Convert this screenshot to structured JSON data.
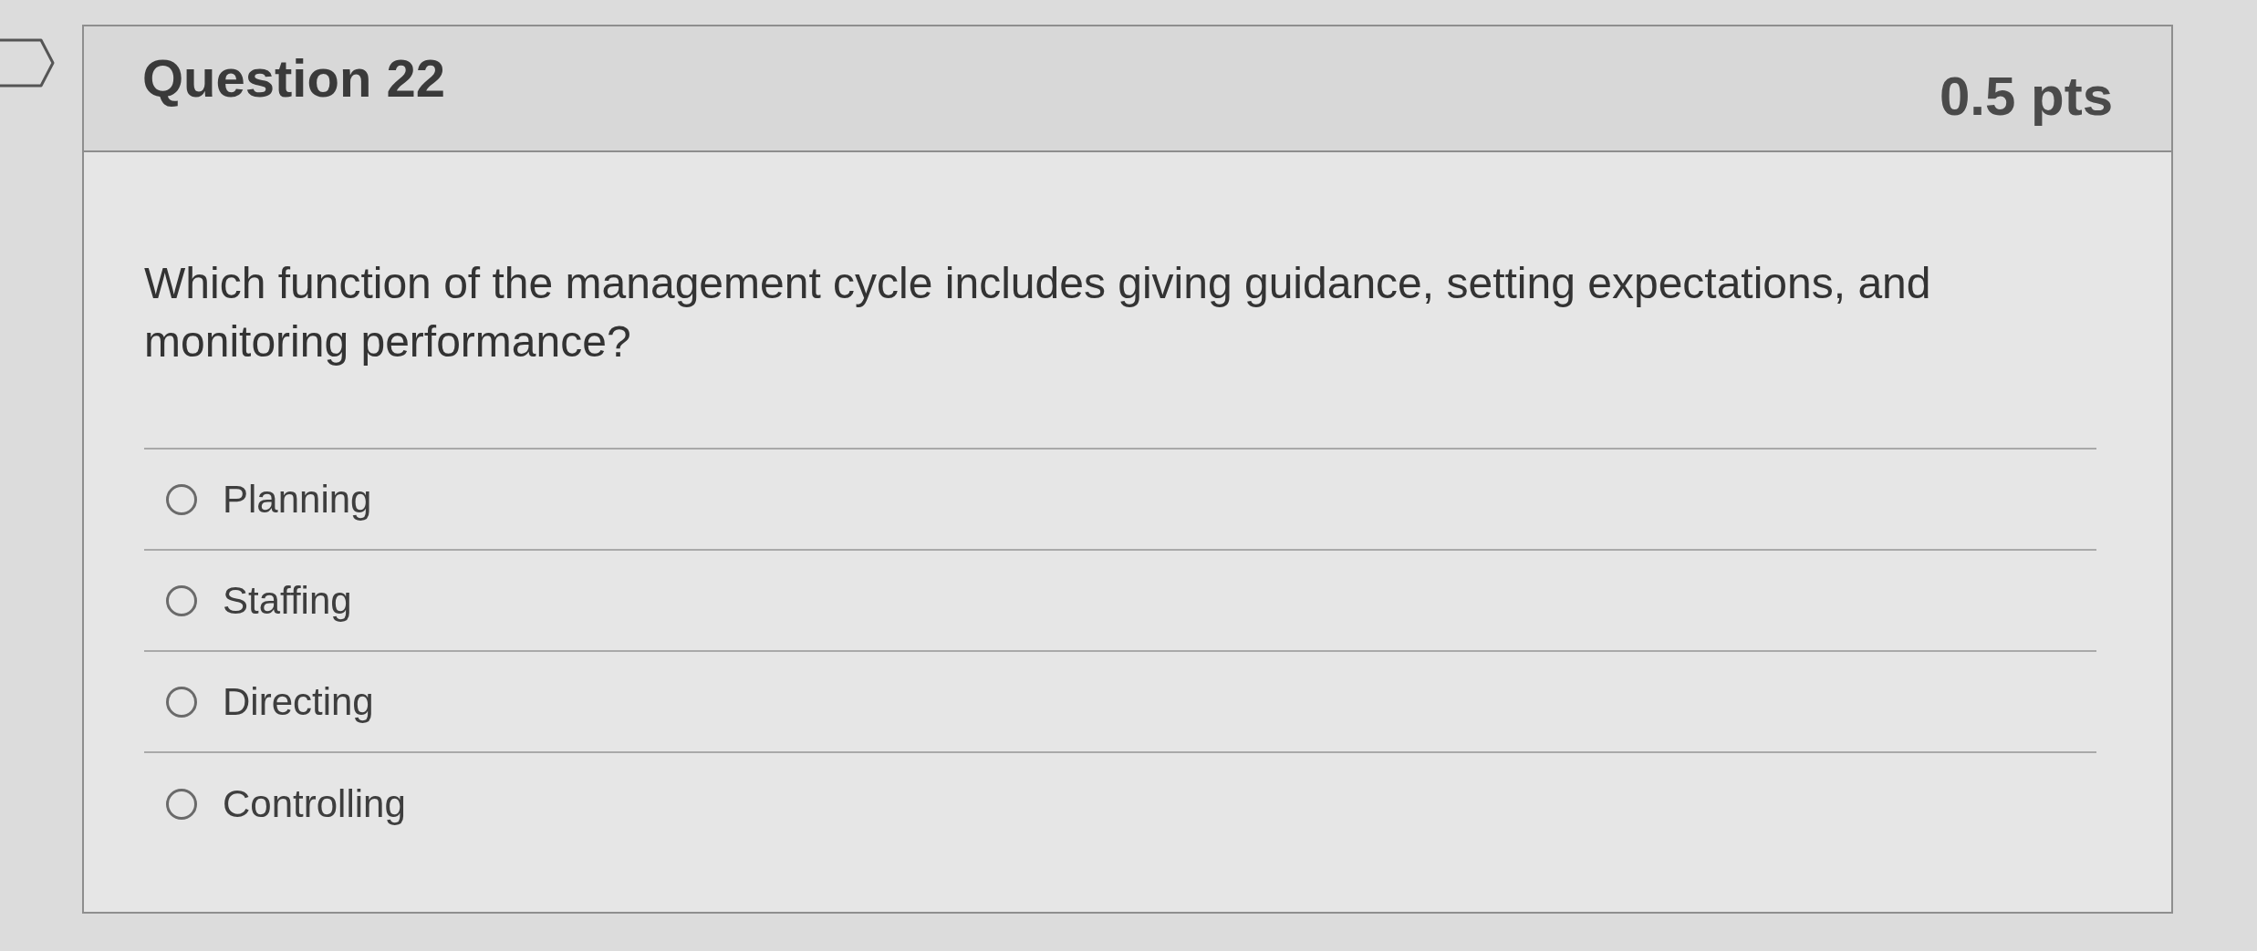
{
  "question": {
    "flagged": false,
    "title": "Question 22",
    "points": "0.5 pts",
    "text": "Which function of the management cycle includes giving guidance, setting expectations, and monitoring performance?",
    "options": [
      {
        "label": "Planning",
        "selected": false
      },
      {
        "label": "Staffing",
        "selected": false
      },
      {
        "label": "Directing",
        "selected": false
      },
      {
        "label": "Controlling",
        "selected": false
      }
    ]
  }
}
